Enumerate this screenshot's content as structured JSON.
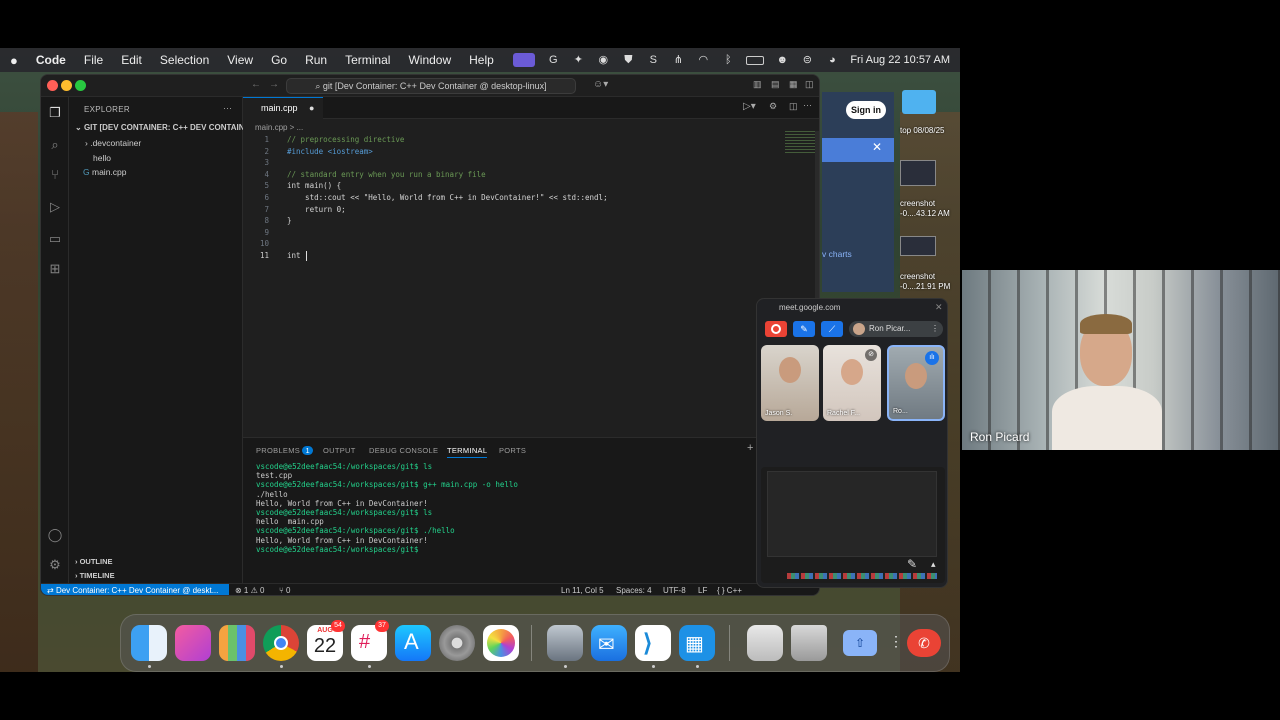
{
  "menubar": {
    "app": "Code",
    "items": [
      "File",
      "Edit",
      "Selection",
      "View",
      "Go",
      "Run",
      "Terminal",
      "Window",
      "Help"
    ],
    "datetime": "Fri Aug 22  10:57 AM"
  },
  "vscode": {
    "search": "git [Dev Container: C++ Dev Container @ desktop-linux]",
    "explorer": {
      "header": "EXPLORER",
      "folder": "GIT [DEV CONTAINER: C++ DEV CONTAIN...",
      "items": [
        ".devcontainer",
        "hello",
        "main.cpp"
      ],
      "outline": "OUTLINE",
      "timeline": "TIMELINE"
    },
    "tab": "main.cpp",
    "breadcrumb": "main.cpp > ...",
    "code": [
      {
        "n": "1",
        "t": "// preprocessing directive"
      },
      {
        "n": "2",
        "t": "#include <iostream>"
      },
      {
        "n": "3",
        "t": ""
      },
      {
        "n": "4",
        "t": "// standard entry when you run a binary file"
      },
      {
        "n": "5",
        "t": "int main() {"
      },
      {
        "n": "6",
        "t": "    std::cout << \"Hello, World from C++ in DevContainer!\" << std::endl;"
      },
      {
        "n": "7",
        "t": "    return 0;"
      },
      {
        "n": "8",
        "t": "}"
      },
      {
        "n": "9",
        "t": ""
      },
      {
        "n": "10",
        "t": ""
      },
      {
        "n": "11",
        "t": "int "
      }
    ],
    "panel_tabs": [
      "PROBLEMS",
      "OUTPUT",
      "DEBUG CONSOLE",
      "TERMINAL",
      "PORTS"
    ],
    "problems_count": "1",
    "terminal": [
      "vscode@e52deefaac54:/workspaces/git$ ls",
      "test.cpp",
      "vscode@e52deefaac54:/workspaces/git$ g++ main.cpp -o hello",
      "./hello",
      "Hello, World from C++ in DevContainer!",
      "vscode@e52deefaac54:/workspaces/git$ ls",
      "hello  main.cpp",
      "vscode@e52deefaac54:/workspaces/git$ ./hello",
      "Hello, World from C++ in DevContainer!",
      "vscode@e52deefaac54:/workspaces/git$ "
    ],
    "status": {
      "remote": "Dev Container: C++ Dev Container @ deskt...",
      "errors": "⊗ 1 ⚠ 0",
      "ports": "⑂ 0",
      "position": "Ln 11, Col 5",
      "spaces": "Spaces: 4",
      "encoding": "UTF-8",
      "eol": "LF",
      "language": "{ } C++"
    }
  },
  "desktop": {
    "signin": "Sign in",
    "charts_link": "v charts",
    "labels": [
      "top 08/08/25",
      "creenshot",
      "-0....43.12 AM",
      "creenshot",
      "-0....21.91 PM"
    ]
  },
  "meet": {
    "url": "meet.google.com",
    "host": "Ron Picar...",
    "tiles": [
      "Jason S.",
      "Rachel F...",
      "Ro..."
    ]
  },
  "video": {
    "name": "Ron Picard"
  },
  "dock": {
    "calendar_month": "AUG",
    "calendar_day": "22",
    "calendar_badge": "54",
    "slack_badge": "37"
  },
  "colors": {
    "accent": "#0078d4",
    "record": "#ea4335",
    "comment": "#6a9955",
    "keyword": "#569cd6",
    "string": "#ce9178",
    "prompt": "#23d18b"
  }
}
